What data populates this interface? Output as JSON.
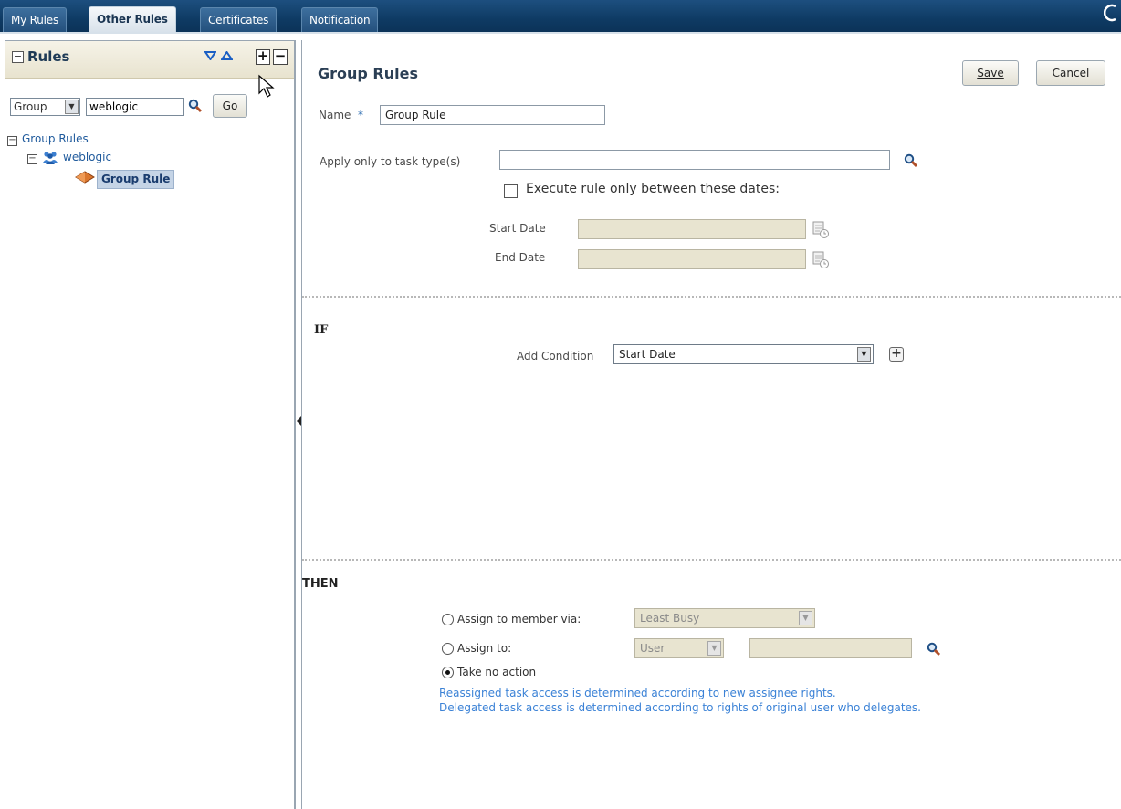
{
  "tabs": [
    {
      "label": "My Rules",
      "active": false
    },
    {
      "label": "Other Rules",
      "active": true
    },
    {
      "label": "Certificates",
      "active": false
    },
    {
      "label": "Notification",
      "active": false
    }
  ],
  "left_panel": {
    "title": "Rules",
    "filter": {
      "type_value": "Group",
      "search_value": "weblogic",
      "go_label": "Go"
    },
    "tree": {
      "root_label": "Group Rules",
      "group_label": "weblogic",
      "rule_label": "Group Rule"
    }
  },
  "form": {
    "title": "Group Rules",
    "save_label": "Save",
    "cancel_label": "Cancel",
    "name_label": "Name",
    "required_marker": "*",
    "name_value": "Group Rule",
    "task_type_label": "Apply only to task type(s)",
    "task_type_value": "",
    "execute_checkbox_label": "Execute rule only between these dates:",
    "execute_checked": false,
    "start_date_label": "Start Date",
    "end_date_label": "End Date"
  },
  "if_section": {
    "heading": "IF",
    "add_condition_label": "Add Condition",
    "add_condition_value": "Start Date"
  },
  "then_section": {
    "heading": "THEN",
    "assign_member_label": "Assign to member via:",
    "assign_member_value": "Least Busy",
    "assign_to_label": "Assign to:",
    "assign_to_type": "User",
    "assign_to_value": "",
    "no_action_label": "Take no action",
    "selected_option": "Take no action",
    "info_line_1": "Reassigned task access is determined according to new assignee rights.",
    "info_line_2": "Delegated task access is determined according to rights of original user who delegates."
  },
  "colors": {
    "tabbar": "#0e3a63",
    "link": "#1f5a9c",
    "info_text": "#3b82d6",
    "selection": "#c5d4e6",
    "disabled_field": "#e8e4d0"
  }
}
